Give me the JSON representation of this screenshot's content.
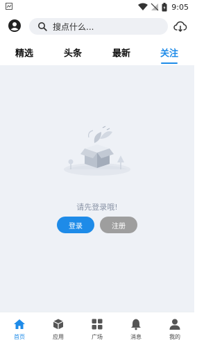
{
  "status_bar": {
    "time": "9:05"
  },
  "header": {
    "search_placeholder": "搜点什么..."
  },
  "tabs": [
    {
      "label": "精选",
      "active": false
    },
    {
      "label": "头条",
      "active": false
    },
    {
      "label": "最新",
      "active": false
    },
    {
      "label": "关注",
      "active": true
    }
  ],
  "empty_state": {
    "message": "请先登录哦!",
    "login_label": "登录",
    "register_label": "注册"
  },
  "bottom_nav": [
    {
      "label": "首页",
      "icon": "home-icon",
      "active": true
    },
    {
      "label": "应用",
      "icon": "box-icon",
      "active": false
    },
    {
      "label": "广场",
      "icon": "grid-icon",
      "active": false
    },
    {
      "label": "消息",
      "icon": "bell-icon",
      "active": false
    },
    {
      "label": "我的",
      "icon": "user-icon",
      "active": false
    }
  ],
  "colors": {
    "accent": "#1e8be8",
    "content_background": "#eef1f6",
    "register_button": "#9e9e9e"
  }
}
